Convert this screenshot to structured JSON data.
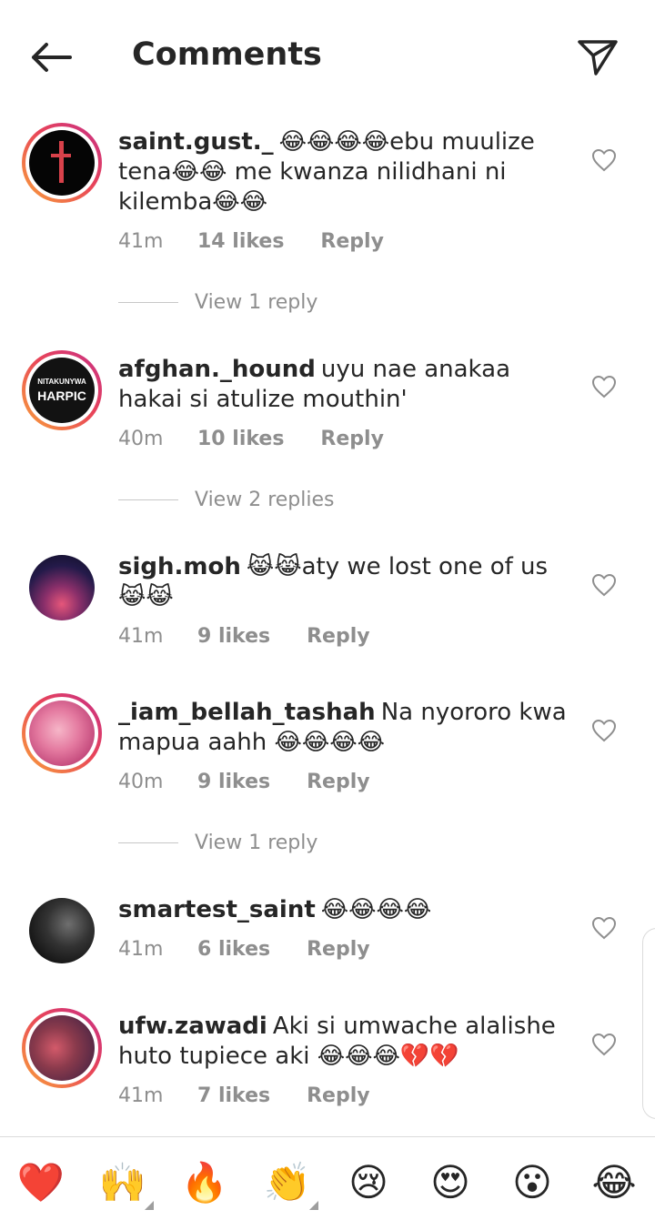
{
  "header": {
    "title": "Comments",
    "back_icon": "arrow-left-icon",
    "send_icon": "paper-plane-icon"
  },
  "comments": [
    {
      "username": "saint.gust._",
      "text": "😂😂😂😂ebu muulize tena😂😂 me kwanza nilidhani ni kilemba😂😂",
      "time": "41m",
      "likes": "14 likes",
      "reply": "Reply",
      "view_replies": "View 1 reply"
    },
    {
      "username": "afghan._hound",
      "text": "uyu nae anakaa hakai si atulize mouthin'",
      "time": "40m",
      "likes": "10 likes",
      "reply": "Reply",
      "view_replies": "View 2 replies",
      "avatar_text_top": "NITAKUNYWA",
      "avatar_text_bottom": "HARPIC"
    },
    {
      "username": "sigh.moh",
      "text": "😹😹aty we lost one of us 😹😹",
      "time": "41m",
      "likes": "9 likes",
      "reply": "Reply"
    },
    {
      "username": "_iam_bellah_tashah",
      "text": "Na nyororo kwa mapua aahh 😂😂😂😂",
      "time": "40m",
      "likes": "9 likes",
      "reply": "Reply",
      "view_replies": "View 1 reply"
    },
    {
      "username": "smartest_saint",
      "text": "😂😂😂😂",
      "time": "41m",
      "likes": "6 likes",
      "reply": "Reply"
    },
    {
      "username": "ufw.zawadi",
      "text": "Aki si umwache alalishe huto tupiece aki 😂😂😂💔💔",
      "time": "41m",
      "likes": "7 likes",
      "reply": "Reply"
    }
  ],
  "emoji_bar": [
    "❤️",
    "🙌",
    "🔥",
    "👏",
    "😢",
    "😍",
    "😮",
    "😂"
  ],
  "colors": {
    "text": "#262626",
    "secondary": "#8e8e8e",
    "story_ring_start": "#f9a33a",
    "story_ring_end": "#c72f86"
  }
}
